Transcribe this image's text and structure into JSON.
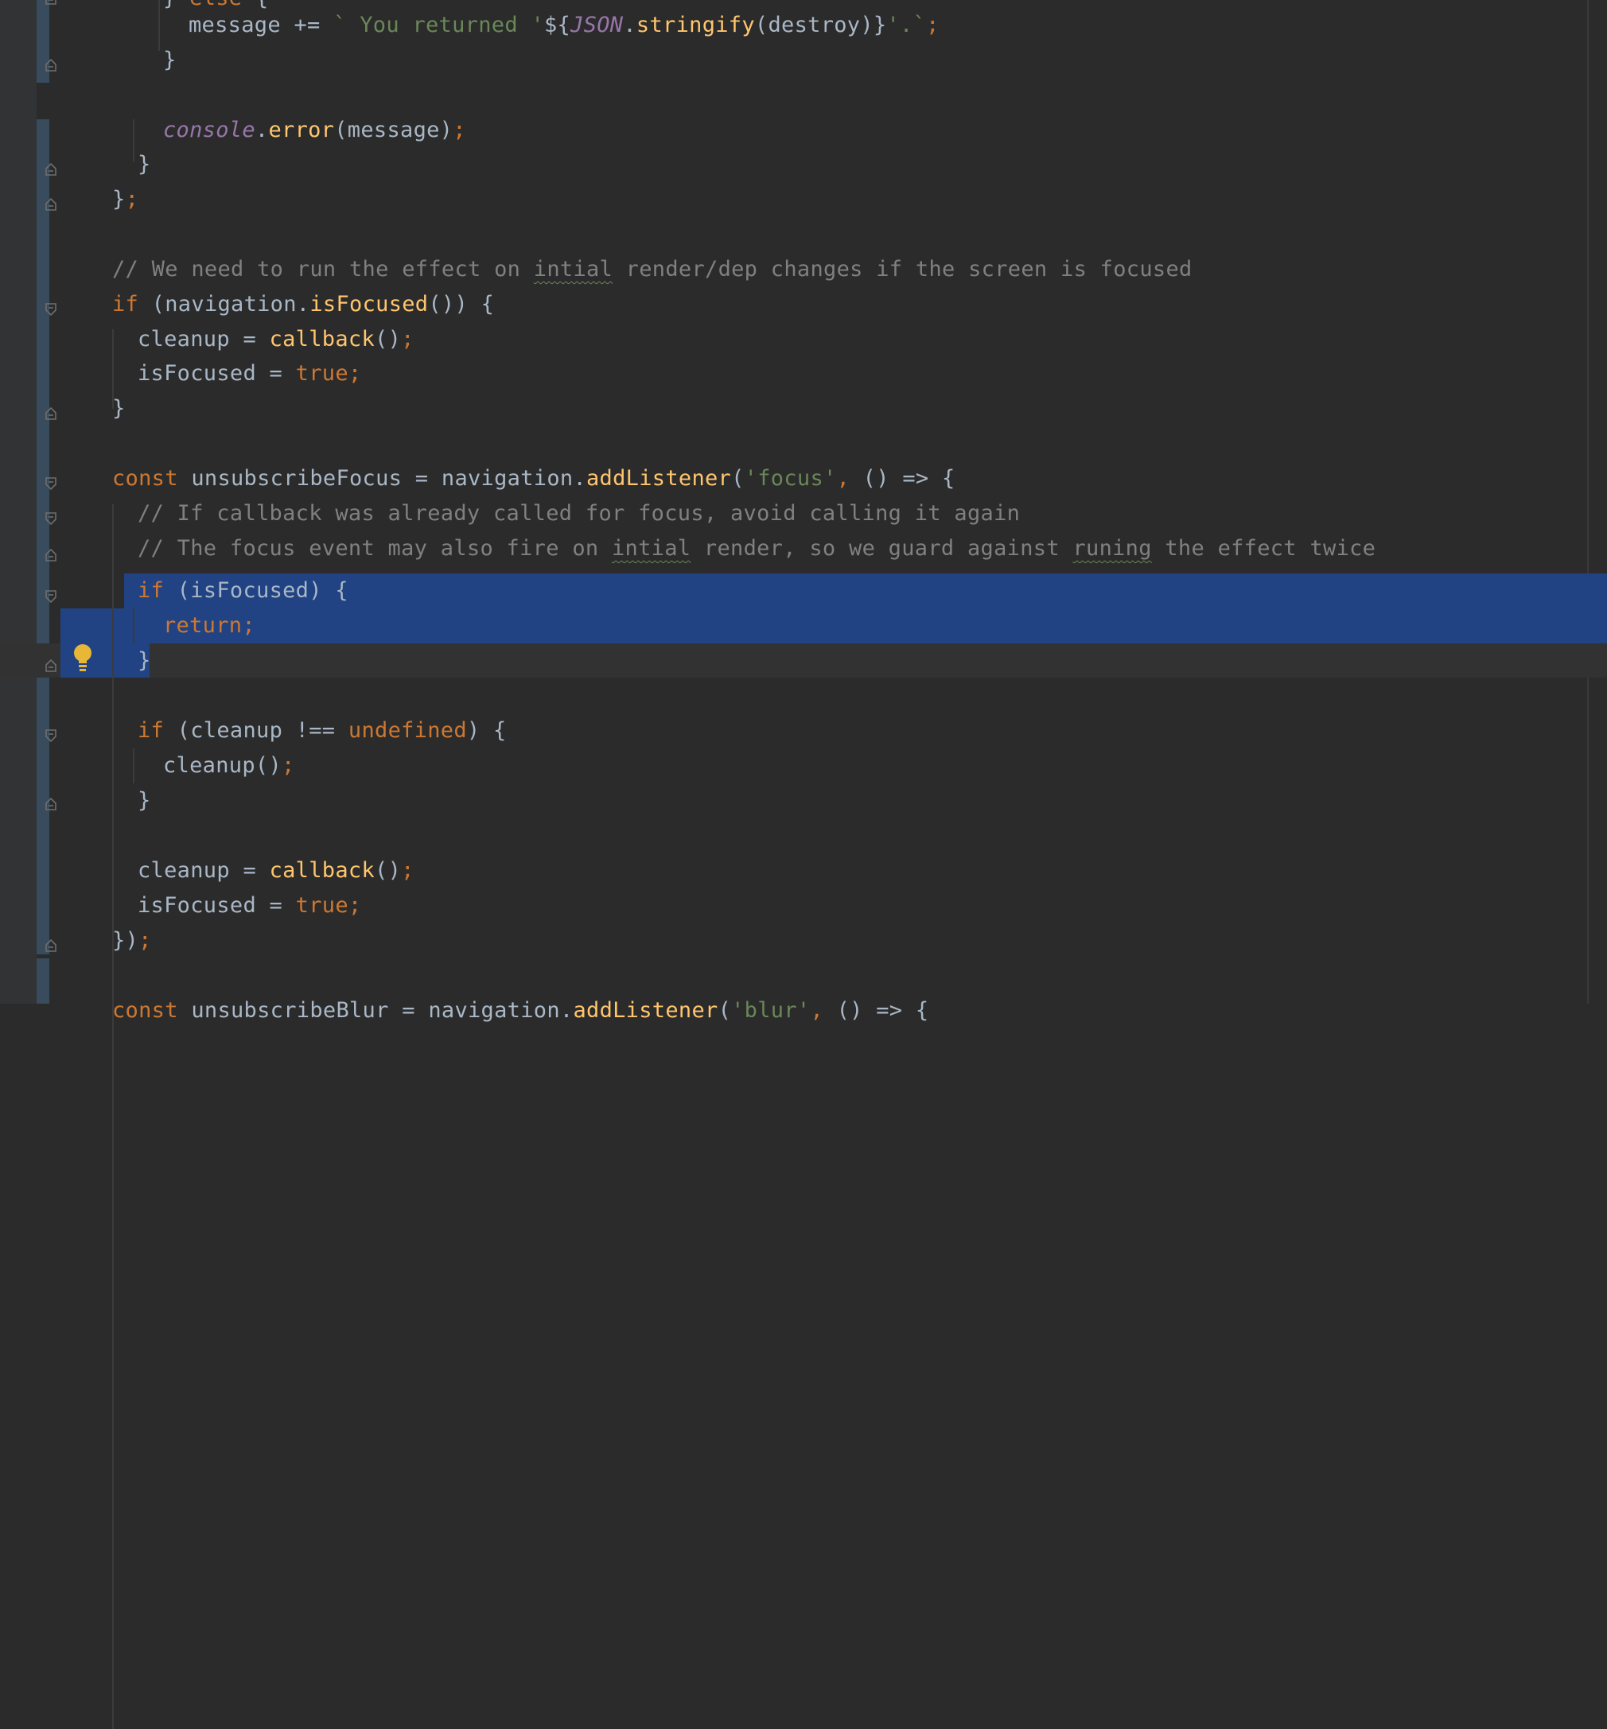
{
  "editor": {
    "language": "javascript",
    "theme_colors": {
      "background": "#2b2b2b",
      "keyword": "#cc7832",
      "function": "#ffc66d",
      "string": "#6a8759",
      "comment": "#808080",
      "global": "#9876aa",
      "selection": "#214283"
    },
    "intention_icon": "lightbulb-icon",
    "lines": [
      {
        "tokens": [
          {
            "t": "} ",
            "c": "t"
          },
          {
            "t": "else",
            "c": "k"
          },
          {
            "t": " {",
            "c": "t"
          }
        ]
      },
      {
        "tokens": [
          {
            "t": "message += ",
            "c": "t"
          },
          {
            "t": "` You returned '",
            "c": "s"
          },
          {
            "t": "${",
            "c": "t"
          },
          {
            "t": "JSON",
            "c": "g"
          },
          {
            "t": ".",
            "c": "t"
          },
          {
            "t": "stringify",
            "c": "f"
          },
          {
            "t": "(destroy)}",
            "c": "t"
          },
          {
            "t": "'.`",
            "c": "s"
          },
          {
            "t": ";",
            "c": "k"
          }
        ]
      },
      {
        "tokens": [
          {
            "t": "}",
            "c": "t"
          }
        ]
      },
      {
        "tokens": []
      },
      {
        "tokens": [
          {
            "t": "console",
            "c": "g"
          },
          {
            "t": ".",
            "c": "t"
          },
          {
            "t": "error",
            "c": "f"
          },
          {
            "t": "(message)",
            "c": "t"
          },
          {
            "t": ";",
            "c": "k"
          }
        ]
      },
      {
        "tokens": [
          {
            "t": "}",
            "c": "t"
          }
        ]
      },
      {
        "tokens": [
          {
            "t": "}",
            "c": "t"
          },
          {
            "t": ";",
            "c": "k"
          }
        ]
      },
      {
        "tokens": []
      },
      {
        "tokens": [
          {
            "t": "// We need to run the effect on ",
            "c": "c"
          },
          {
            "t": "intial",
            "c": "c typo"
          },
          {
            "t": " render/dep changes if the screen is focused",
            "c": "c"
          }
        ]
      },
      {
        "tokens": [
          {
            "t": "if",
            "c": "k"
          },
          {
            "t": " (navigation.",
            "c": "t"
          },
          {
            "t": "isFocused",
            "c": "f"
          },
          {
            "t": "()) {",
            "c": "t"
          }
        ]
      },
      {
        "tokens": [
          {
            "t": "cleanup = ",
            "c": "t"
          },
          {
            "t": "callback",
            "c": "f"
          },
          {
            "t": "()",
            "c": "t"
          },
          {
            "t": ";",
            "c": "k"
          }
        ]
      },
      {
        "tokens": [
          {
            "t": "isFocused = ",
            "c": "t"
          },
          {
            "t": "true;",
            "c": "k"
          }
        ]
      },
      {
        "tokens": [
          {
            "t": "}",
            "c": "t"
          }
        ]
      },
      {
        "tokens": []
      },
      {
        "tokens": [
          {
            "t": "const",
            "c": "k"
          },
          {
            "t": " unsubscribeFocus = navigation.",
            "c": "t"
          },
          {
            "t": "addListener",
            "c": "f"
          },
          {
            "t": "(",
            "c": "t"
          },
          {
            "t": "'focus'",
            "c": "s"
          },
          {
            "t": ",",
            "c": "k"
          },
          {
            "t": " () => {",
            "c": "t"
          }
        ]
      },
      {
        "tokens": [
          {
            "t": "// If callback was already called for focus, avoid calling it again",
            "c": "c"
          }
        ]
      },
      {
        "tokens": [
          {
            "t": "// The focus event may also fire on ",
            "c": "c"
          },
          {
            "t": "intial",
            "c": "c typo"
          },
          {
            "t": " render, so we guard against ",
            "c": "c"
          },
          {
            "t": "runing",
            "c": "c typo"
          },
          {
            "t": " the effect twice",
            "c": "c"
          }
        ]
      },
      {
        "tokens": [
          {
            "t": "if",
            "c": "k"
          },
          {
            "t": " (isFocused) {",
            "c": "t"
          }
        ]
      },
      {
        "tokens": [
          {
            "t": "return;",
            "c": "k"
          }
        ]
      },
      {
        "tokens": [
          {
            "t": "}",
            "c": "t"
          }
        ]
      },
      {
        "tokens": []
      },
      {
        "tokens": [
          {
            "t": "if",
            "c": "k"
          },
          {
            "t": " (cleanup !== ",
            "c": "t"
          },
          {
            "t": "undefined",
            "c": "k"
          },
          {
            "t": ") {",
            "c": "t"
          }
        ]
      },
      {
        "tokens": [
          {
            "t": "cleanup()",
            "c": "t"
          },
          {
            "t": ";",
            "c": "k"
          }
        ]
      },
      {
        "tokens": [
          {
            "t": "}",
            "c": "t"
          }
        ]
      },
      {
        "tokens": []
      },
      {
        "tokens": [
          {
            "t": "cleanup = ",
            "c": "t"
          },
          {
            "t": "callback",
            "c": "f"
          },
          {
            "t": "()",
            "c": "t"
          },
          {
            "t": ";",
            "c": "k"
          }
        ]
      },
      {
        "tokens": [
          {
            "t": "isFocused = ",
            "c": "t"
          },
          {
            "t": "true;",
            "c": "k"
          }
        ]
      },
      {
        "tokens": [
          {
            "t": "})",
            "c": "t"
          },
          {
            "t": ";",
            "c": "k"
          }
        ]
      },
      {
        "tokens": []
      },
      {
        "tokens": [
          {
            "t": "const",
            "c": "k"
          },
          {
            "t": " unsubscribeBlur = navigation.",
            "c": "t"
          },
          {
            "t": "addListener",
            "c": "f"
          },
          {
            "t": "(",
            "c": "t"
          },
          {
            "t": "'blur'",
            "c": "s"
          },
          {
            "t": ",",
            "c": "k"
          },
          {
            "t": " () => {",
            "c": "t"
          }
        ]
      }
    ]
  }
}
